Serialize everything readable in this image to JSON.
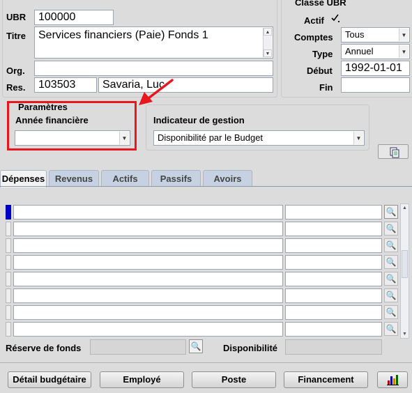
{
  "colors": {
    "annotation": "#e8171f",
    "record_marker": "#0000cc",
    "tab_inactive": "#c6d2e2"
  },
  "header": {
    "ubr_label": "UBR",
    "ubr_value": "100000",
    "titre_label": "Titre",
    "titre_value": "Services financiers (Paie) Fonds 1",
    "org_label": "Org.",
    "org_value": "",
    "res_label": "Res.",
    "res_code": "103503",
    "res_name": "Savaria, Luc"
  },
  "classe": {
    "title": "Classe UBR",
    "actif_label": "Actif",
    "actif_checked": true,
    "comptes_label": "Comptes",
    "comptes_value": "Tous",
    "type_label": "Type",
    "type_value": "Annuel",
    "debut_label": "Début",
    "debut_value": "1992-01-01",
    "fin_label": "Fin",
    "fin_value": ""
  },
  "parametres": {
    "title": "Paramètres",
    "annee_label": "Année financière",
    "annee_value": ""
  },
  "indicateur": {
    "label": "Indicateur de gestion",
    "value": "Disponibilité par le Budget"
  },
  "tabs": [
    {
      "label": "Dépenses",
      "active": true
    },
    {
      "label": "Revenus",
      "active": false
    },
    {
      "label": "Actifs",
      "active": false
    },
    {
      "label": "Passifs",
      "active": false
    },
    {
      "label": "Avoirs",
      "active": false
    }
  ],
  "grid_rows": [
    {
      "account": "",
      "amount": ""
    },
    {
      "account": "",
      "amount": ""
    },
    {
      "account": "",
      "amount": ""
    },
    {
      "account": "",
      "amount": ""
    },
    {
      "account": "",
      "amount": ""
    },
    {
      "account": "",
      "amount": ""
    },
    {
      "account": "",
      "amount": ""
    },
    {
      "account": "",
      "amount": ""
    }
  ],
  "footer": {
    "reserve_label": "Réserve de fonds",
    "reserve_value": "",
    "dispo_label": "Disponibilité",
    "dispo_value": ""
  },
  "buttons": {
    "detail": "Détail budgétaire",
    "employe": "Employé",
    "poste": "Poste",
    "financement": "Financement"
  },
  "icons": {
    "checkbox": "checkmark-icon",
    "lov": "magnifier-icon",
    "attach": "attachment-icon",
    "chart": "bar-chart-icon"
  }
}
